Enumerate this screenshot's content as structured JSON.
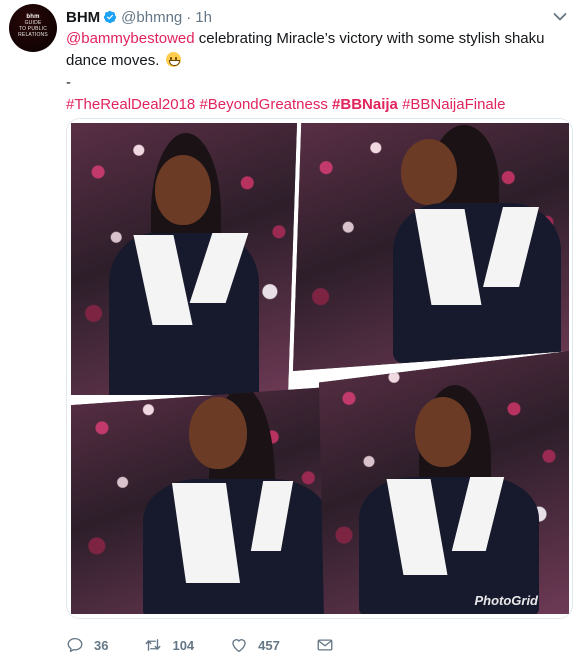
{
  "tweet": {
    "author": {
      "display_name": "BHM",
      "handle": "@bhmng",
      "verified": true,
      "avatar_text": [
        "bhm",
        "GUIDE",
        "TO PUBLIC",
        "RELATIONS"
      ]
    },
    "separator": "·",
    "time": "1h",
    "text": {
      "mention": "@bammybestowed",
      "body": " celebrating Miracle’s victory with some stylish shaku dance moves. ",
      "emoji": "grinning-face",
      "dash": "-",
      "hashtags": [
        {
          "tag": "#TheRealDeal2018",
          "bold": false
        },
        {
          "tag": "#BeyondGreatness",
          "bold": false
        },
        {
          "tag": "#BBNaija",
          "bold": true
        },
        {
          "tag": "#BBNaijaFinale",
          "bold": false
        }
      ]
    },
    "photo": {
      "watermark": "PhotoGrid"
    },
    "actions": {
      "reply_count": "36",
      "retweet_count": "104",
      "like_count": "457"
    }
  },
  "colors": {
    "accent": "#e0245e",
    "muted": "#657786",
    "verified": "#1da1f2"
  }
}
